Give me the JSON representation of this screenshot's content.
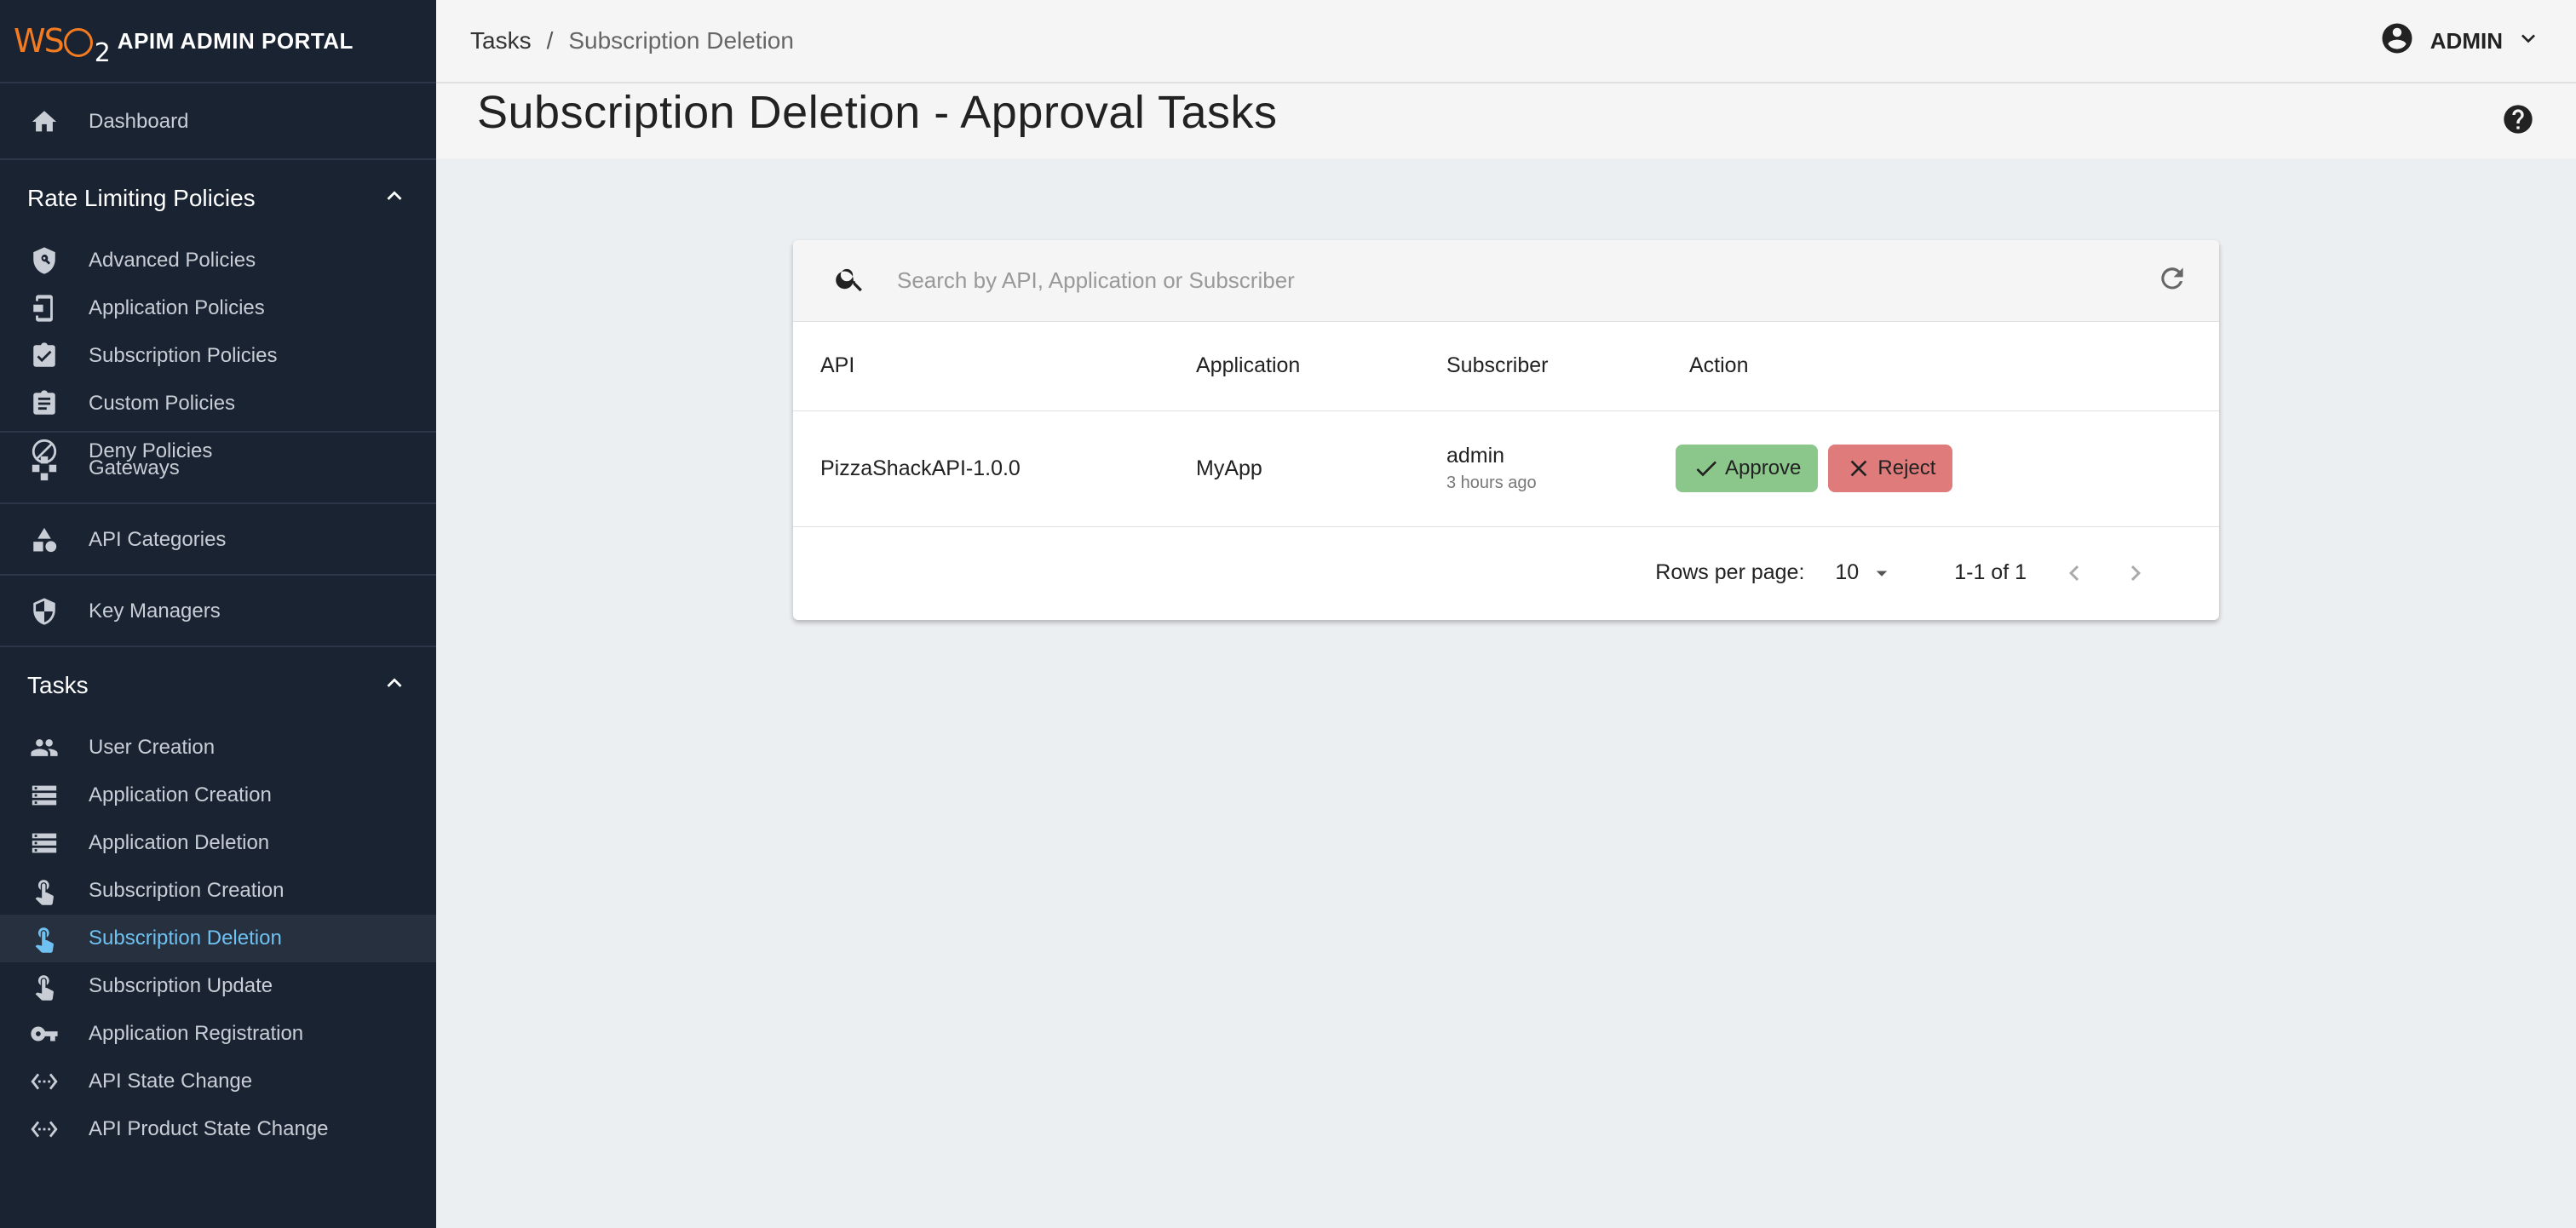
{
  "brand": {
    "logo": "WSO2",
    "title": "APIM ADMIN PORTAL"
  },
  "sidebar": {
    "dashboard": "Dashboard",
    "rate_limiting": {
      "title": "Rate Limiting Policies",
      "items": [
        "Advanced Policies",
        "Application Policies",
        "Subscription Policies",
        "Custom Policies",
        "Deny Policies"
      ]
    },
    "gateways": "Gateways",
    "api_categories": "API Categories",
    "key_managers": "Key Managers",
    "tasks": {
      "title": "Tasks",
      "items": [
        "User Creation",
        "Application Creation",
        "Application Deletion",
        "Subscription Creation",
        "Subscription Deletion",
        "Subscription Update",
        "Application Registration",
        "API State Change",
        "API Product State Change"
      ],
      "active": "Subscription Deletion"
    }
  },
  "header": {
    "breadcrumb": {
      "parent": "Tasks",
      "separator": "/",
      "current": "Subscription Deletion"
    },
    "user": "ADMIN"
  },
  "page": {
    "title": "Subscription Deletion - Approval Tasks"
  },
  "search": {
    "placeholder": "Search by API, Application or Subscriber",
    "value": ""
  },
  "table": {
    "columns": [
      "API",
      "Application",
      "Subscriber",
      "Action"
    ],
    "rows": [
      {
        "api": "PizzaShackAPI-1.0.0",
        "application": "MyApp",
        "subscriber": "admin",
        "time": "3 hours ago",
        "approve": "Approve",
        "reject": "Reject"
      }
    ]
  },
  "pagination": {
    "rows_per_page_label": "Rows per page:",
    "rows_per_page": "10",
    "range": "1-1 of 1"
  },
  "colors": {
    "sidebar_bg": "#1a2332",
    "active": "#6ec1f0",
    "approve": "#8bc68a",
    "reject": "#e07b7b",
    "brand": "#f47b20"
  }
}
